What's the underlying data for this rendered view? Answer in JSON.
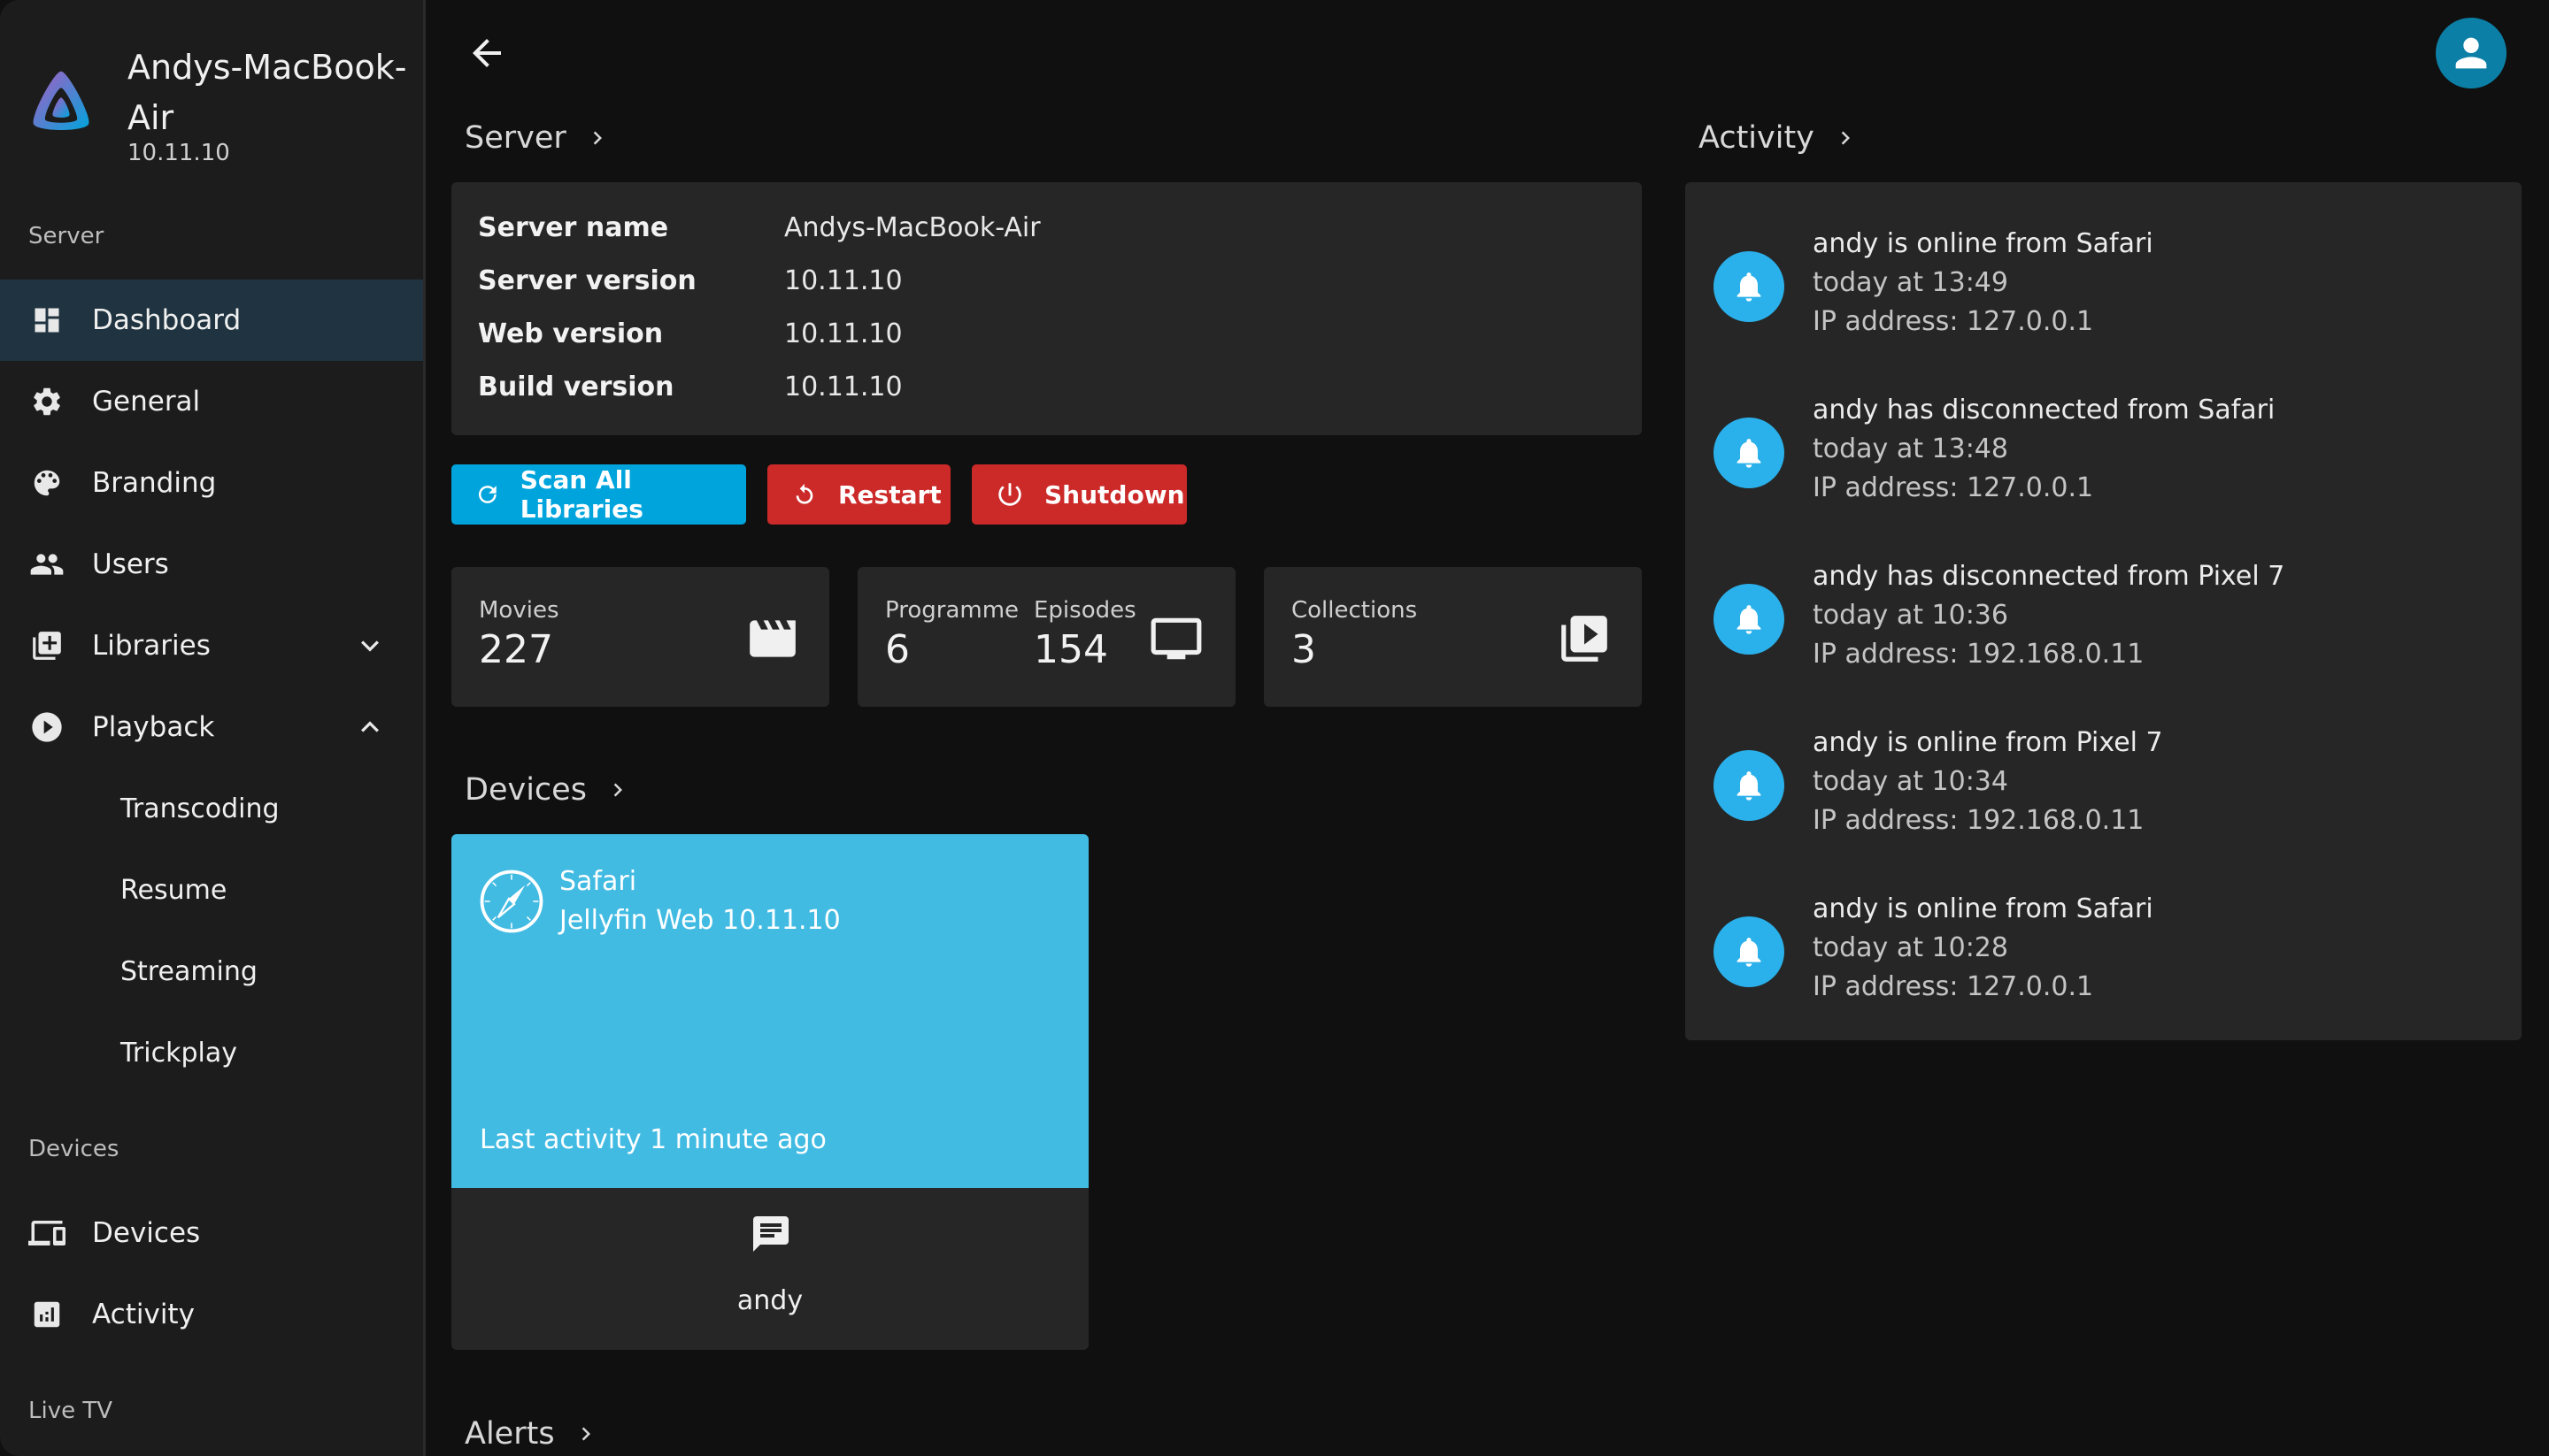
{
  "sidebar": {
    "brand_name": "Andys-MacBook-Air",
    "brand_version": "10.11.10",
    "section_server": "Server",
    "items": [
      {
        "label": "Dashboard",
        "icon": "dashboard-icon"
      },
      {
        "label": "General",
        "icon": "gear-icon"
      },
      {
        "label": "Branding",
        "icon": "palette-icon"
      },
      {
        "label": "Users",
        "icon": "people-icon"
      },
      {
        "label": "Libraries",
        "icon": "library-add-icon"
      },
      {
        "label": "Playback",
        "icon": "play-circle-icon"
      }
    ],
    "playback_sub": [
      "Transcoding",
      "Resume",
      "Streaming",
      "Trickplay"
    ],
    "section_devices": "Devices",
    "device_items": [
      {
        "label": "Devices",
        "icon": "devices-icon"
      },
      {
        "label": "Activity",
        "icon": "analytics-icon"
      }
    ],
    "section_livetv": "Live TV"
  },
  "main": {
    "server_title": "Server",
    "server_info": [
      {
        "key": "Server name",
        "value": "Andys-MacBook-Air"
      },
      {
        "key": "Server version",
        "value": "10.11.10"
      },
      {
        "key": "Web version",
        "value": "10.11.10"
      },
      {
        "key": "Build version",
        "value": "10.11.10"
      }
    ],
    "buttons": {
      "scan": "Scan All Libraries",
      "restart": "Restart",
      "shutdown": "Shutdown"
    },
    "stats": {
      "movies_label": "Movies",
      "movies_value": "227",
      "programme_label": "Programme",
      "programme_value": "6",
      "episodes_label": "Episodes",
      "episodes_value": "154",
      "collections_label": "Collections",
      "collections_value": "3"
    },
    "devices_title": "Devices",
    "device": {
      "name": "Safari",
      "client": "Jellyfin Web 10.11.10",
      "last_activity": "Last activity 1 minute ago",
      "user": "andy"
    },
    "alerts_title": "Alerts",
    "activity_title": "Activity",
    "activity": [
      {
        "title": "andy is online from Safari",
        "time": "today at 13:49",
        "ip": "IP address: 127.0.0.1"
      },
      {
        "title": "andy has disconnected from Safari",
        "time": "today at 13:48",
        "ip": "IP address: 127.0.0.1"
      },
      {
        "title": "andy has disconnected from Pixel 7",
        "time": "today at 10:36",
        "ip": "IP address: 192.168.0.11"
      },
      {
        "title": "andy is online from Pixel 7",
        "time": "today at 10:34",
        "ip": "IP address: 192.168.0.11"
      },
      {
        "title": "andy is online from Safari",
        "time": "today at 10:28",
        "ip": "IP address: 127.0.0.1"
      }
    ]
  },
  "colors": {
    "accent": "#00a4dc",
    "danger": "#cc2929",
    "device_card": "#42bbe3",
    "sidebar_active": "#1f3440"
  }
}
